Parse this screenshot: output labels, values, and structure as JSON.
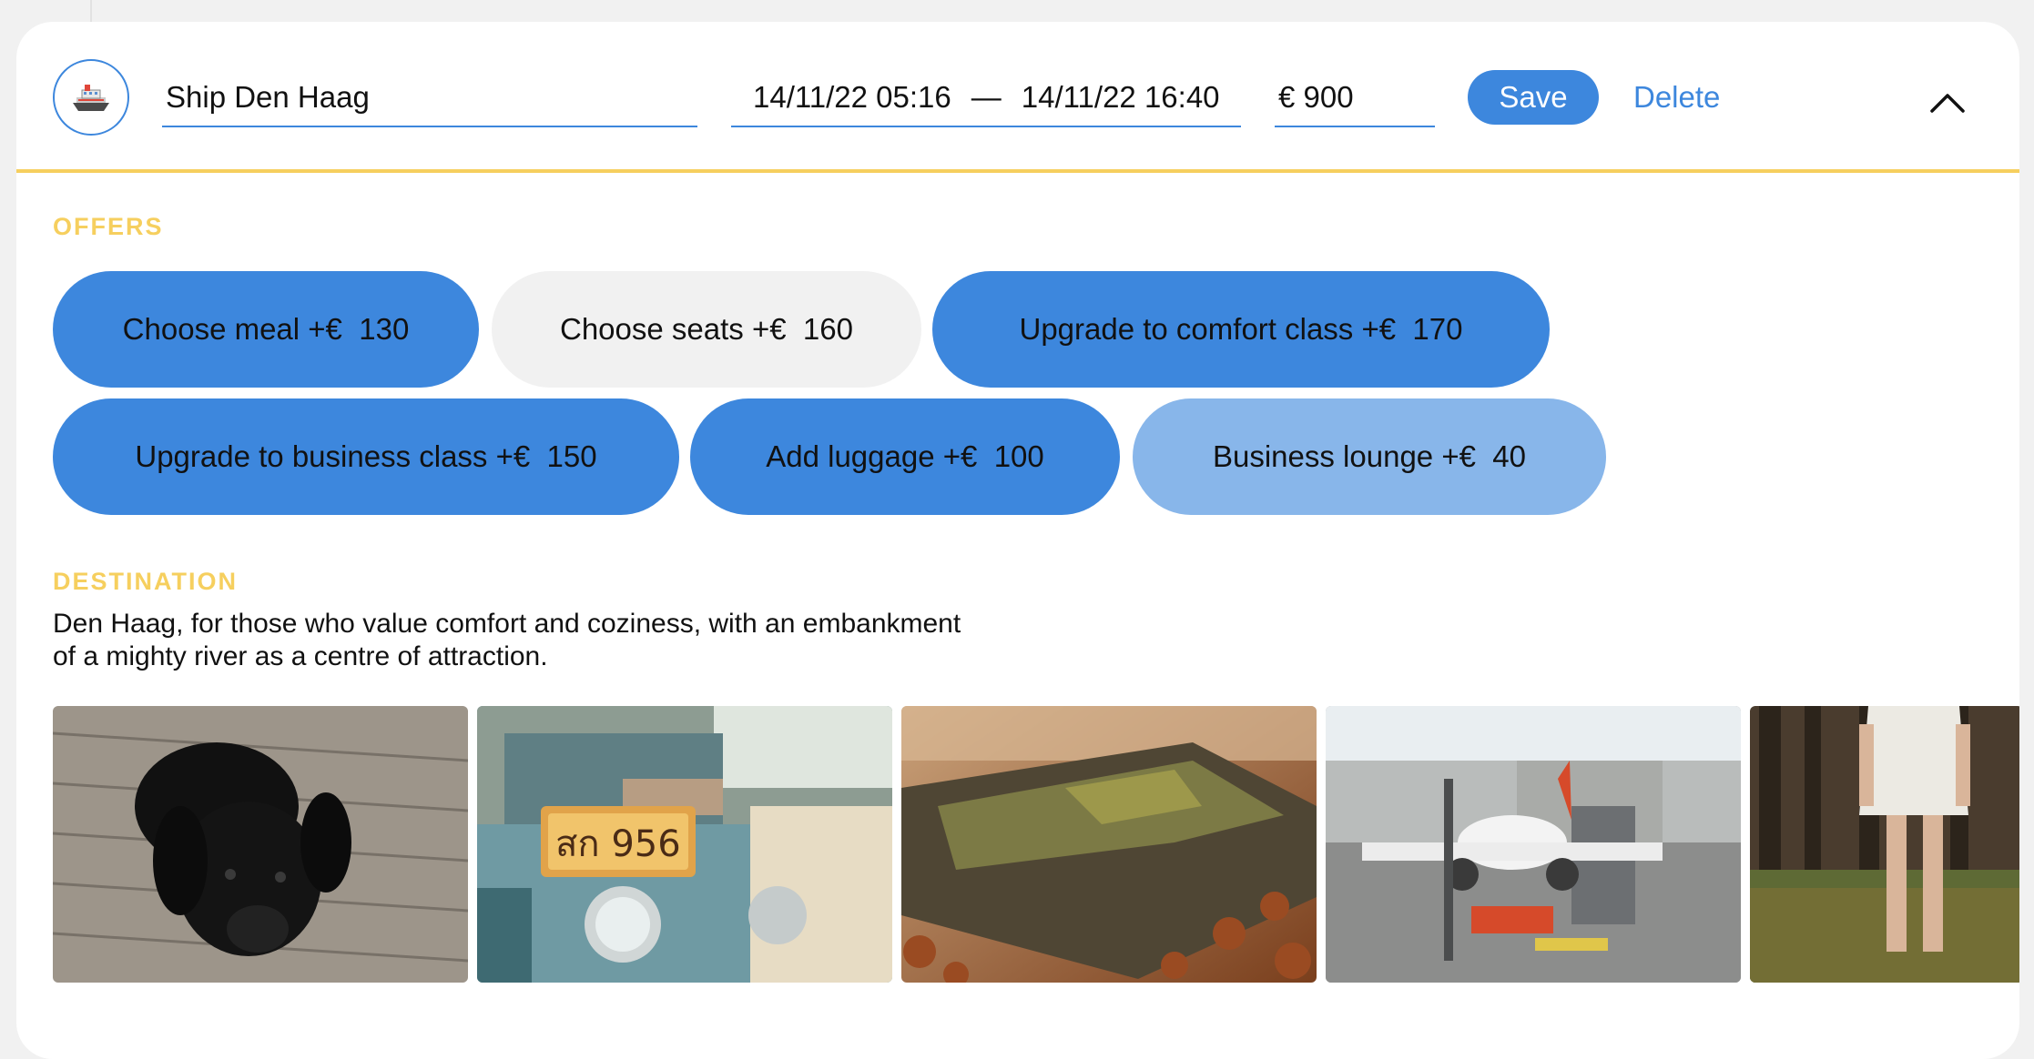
{
  "trip": {
    "name": "Ship Den Haag",
    "date_start": "14/11/22 05:16",
    "date_separator": "—",
    "date_end": "14/11/22 16:40",
    "price": "€ 900",
    "save_label": "Save",
    "delete_label": "Delete",
    "icon": "ship-icon"
  },
  "offers": {
    "label": "OFFERS",
    "items": [
      {
        "label": "Choose meal +€  130",
        "selected": true
      },
      {
        "label": "Choose seats +€  160",
        "selected": false
      },
      {
        "label": "Upgrade to comfort class +€  170",
        "selected": true
      },
      {
        "label": "Upgrade to business class +€  150",
        "selected": true
      },
      {
        "label": "Add luggage +€  100",
        "selected": true
      },
      {
        "label": "Business lounge +€  40",
        "selected": "hover"
      }
    ]
  },
  "destination": {
    "label": "DESTINATION",
    "description": "Den Haag, for those who value comfort and coziness, with an embankment of a mighty river as a centre of attraction.",
    "photos": [
      "black-puppy-photo",
      "tuk-tuk-photo",
      "log-leaves-photo",
      "airplane-airport-photo",
      "forest-woman-photo"
    ]
  },
  "colors": {
    "accent": "#3d87dd",
    "accent_light": "#88b6ea",
    "label_yellow": "#f6cf5e",
    "pill_off": "#f1f1f1"
  }
}
